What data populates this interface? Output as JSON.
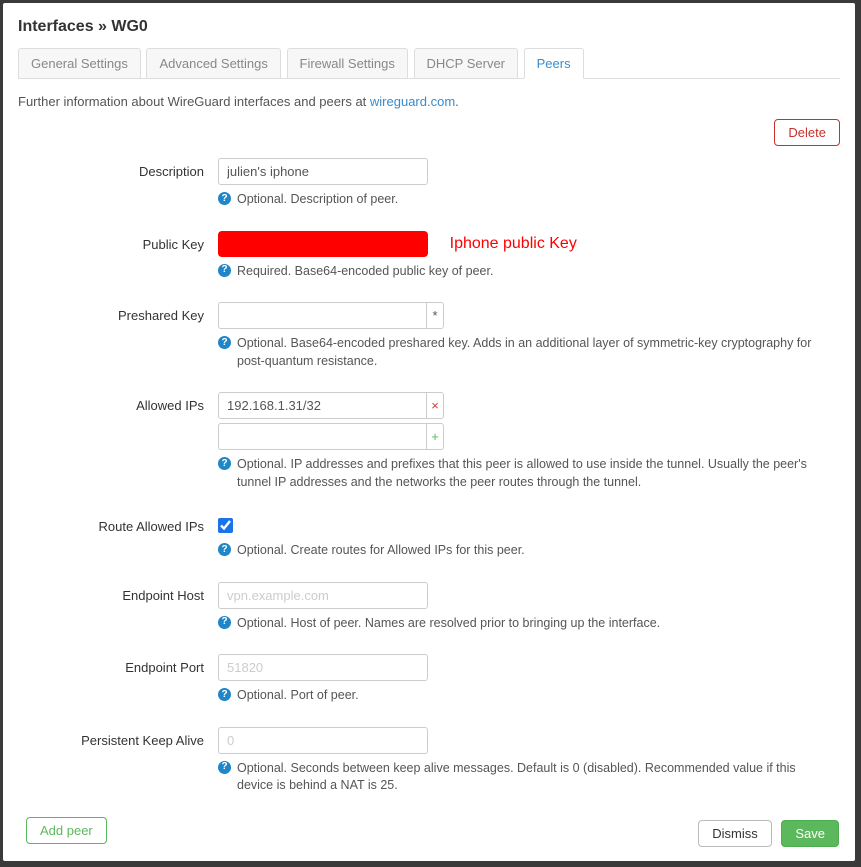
{
  "breadcrumb": "Interfaces » WG0",
  "tabs": {
    "general": "General Settings",
    "advanced": "Advanced Settings",
    "firewall": "Firewall Settings",
    "dhcp": "DHCP Server",
    "peers": "Peers"
  },
  "info": {
    "prefix": "Further information about WireGuard interfaces and peers at ",
    "link_text": "wireguard.com",
    "suffix": "."
  },
  "buttons": {
    "delete": "Delete",
    "add_peer": "Add peer",
    "dismiss": "Dismiss",
    "save": "Save"
  },
  "labels": {
    "description": "Description",
    "public_key": "Public Key",
    "preshared_key": "Preshared Key",
    "allowed_ips": "Allowed IPs",
    "route_allowed": "Route Allowed IPs",
    "endpoint_host": "Endpoint Host",
    "endpoint_port": "Endpoint Port",
    "keep_alive": "Persistent Keep Alive"
  },
  "values": {
    "description": "julien's iphone",
    "preshared_key": "",
    "allowed_ip_0": "192.168.1.31/32",
    "allowed_ip_1": "",
    "route_allowed": true,
    "endpoint_host": "",
    "endpoint_port": "",
    "keep_alive": ""
  },
  "placeholders": {
    "endpoint_host": "vpn.example.com",
    "endpoint_port": "51820",
    "keep_alive": "0"
  },
  "help": {
    "description": "Optional. Description of peer.",
    "public_key": "Required. Base64-encoded public key of peer.",
    "preshared_key": "Optional. Base64-encoded preshared key. Adds in an additional layer of symmetric-key cryptography for post-quantum resistance.",
    "allowed_ips": "Optional. IP addresses and prefixes that this peer is allowed to use inside the tunnel. Usually the peer's tunnel IP addresses and the networks the peer routes through the tunnel.",
    "route_allowed": "Optional. Create routes for Allowed IPs for this peer.",
    "endpoint_host": "Optional. Host of peer. Names are resolved prior to bringing up the interface.",
    "endpoint_port": "Optional. Port of peer.",
    "keep_alive": "Optional. Seconds between keep alive messages. Default is 0 (disabled). Recommended value if this device is behind a NAT is 25."
  },
  "annotation": "Iphone public Key",
  "icons": {
    "remove": "×",
    "add": "+",
    "reveal": "*",
    "help": "?"
  }
}
